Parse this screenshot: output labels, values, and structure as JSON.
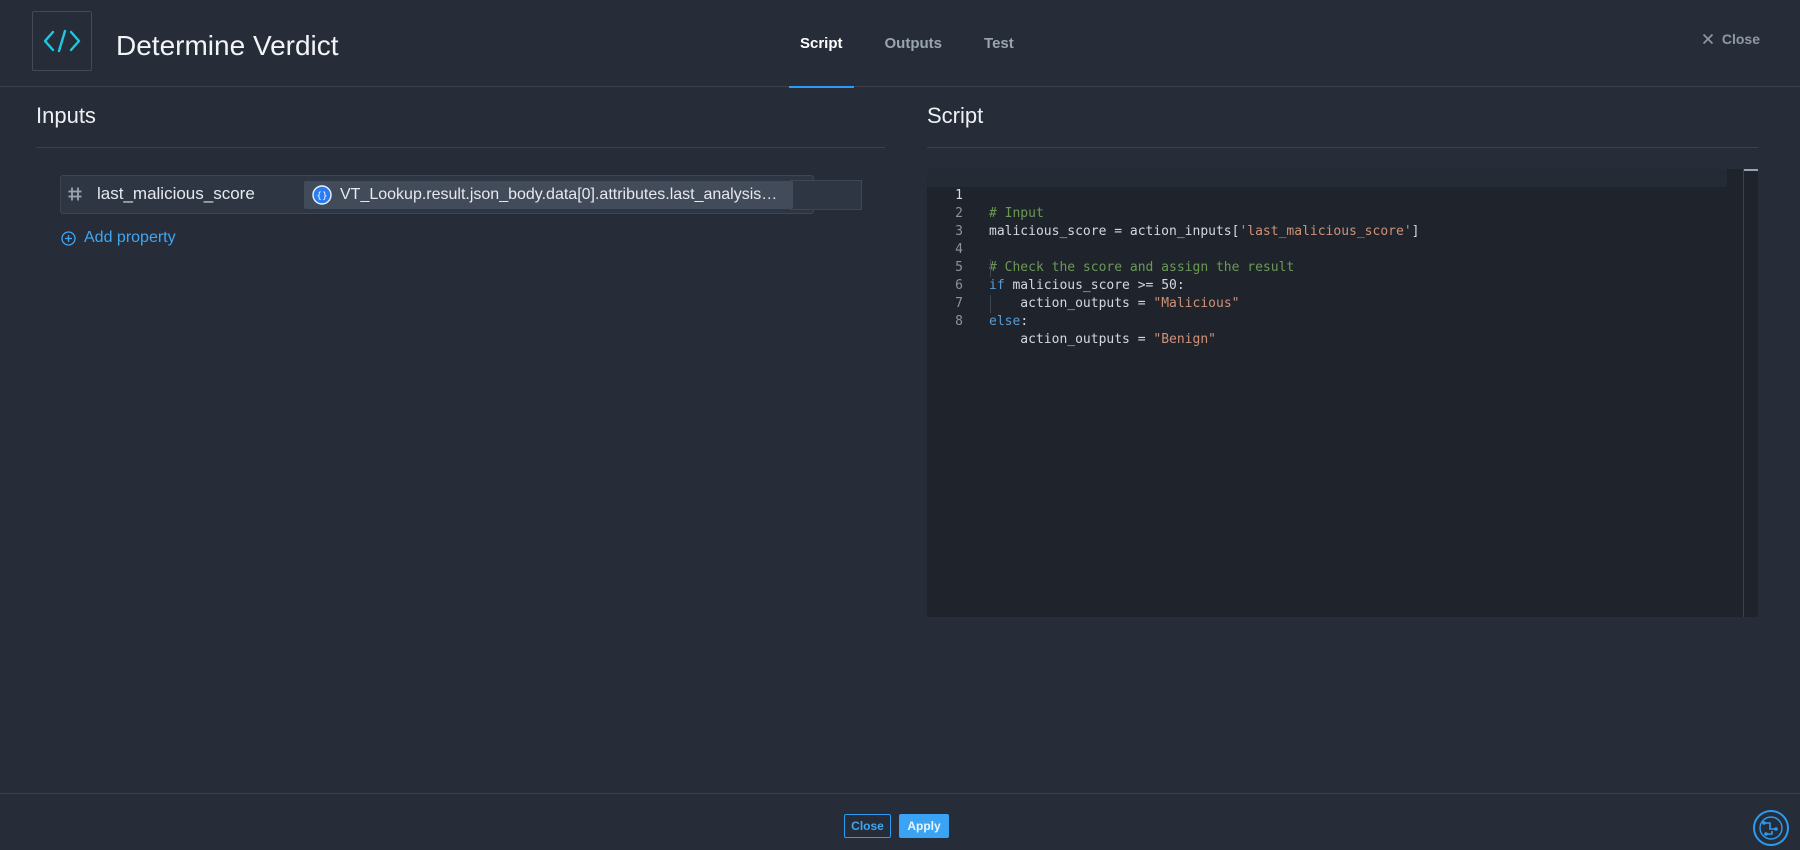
{
  "header": {
    "title": "Determine Verdict",
    "tabs": [
      {
        "label": "Script",
        "active": true
      },
      {
        "label": "Outputs",
        "active": false
      },
      {
        "label": "Test",
        "active": false
      }
    ],
    "close_label": "Close"
  },
  "inputs_panel": {
    "title": "Inputs",
    "properties": [
      {
        "type_icon": "hash-icon",
        "name": "last_malicious_score",
        "value": "VT_Lookup.result.json_body.data[0].attributes.last_analysis_st…"
      }
    ],
    "add_property_label": "Add property"
  },
  "script_panel": {
    "title": "Script",
    "lines": [
      {
        "number": "1",
        "text": "# Input"
      },
      {
        "number": "2",
        "text": "malicious_score = action_inputs['last_malicious_score']"
      },
      {
        "number": "3",
        "text": ""
      },
      {
        "number": "4",
        "text": "# Check the score and assign the result"
      },
      {
        "number": "5",
        "text": "if malicious_score >= 50:"
      },
      {
        "number": "6",
        "text": "    action_outputs = \"Malicious\""
      },
      {
        "number": "7",
        "text": "else:"
      },
      {
        "number": "8",
        "text": "    action_outputs = \"Benign\""
      }
    ]
  },
  "footer": {
    "close_label": "Close",
    "apply_label": "Apply"
  },
  "colors": {
    "accent": "#2b9cf2",
    "background": "#262d38",
    "editor_background": "#1f242c",
    "logo_accent": "#1fc8e0"
  }
}
